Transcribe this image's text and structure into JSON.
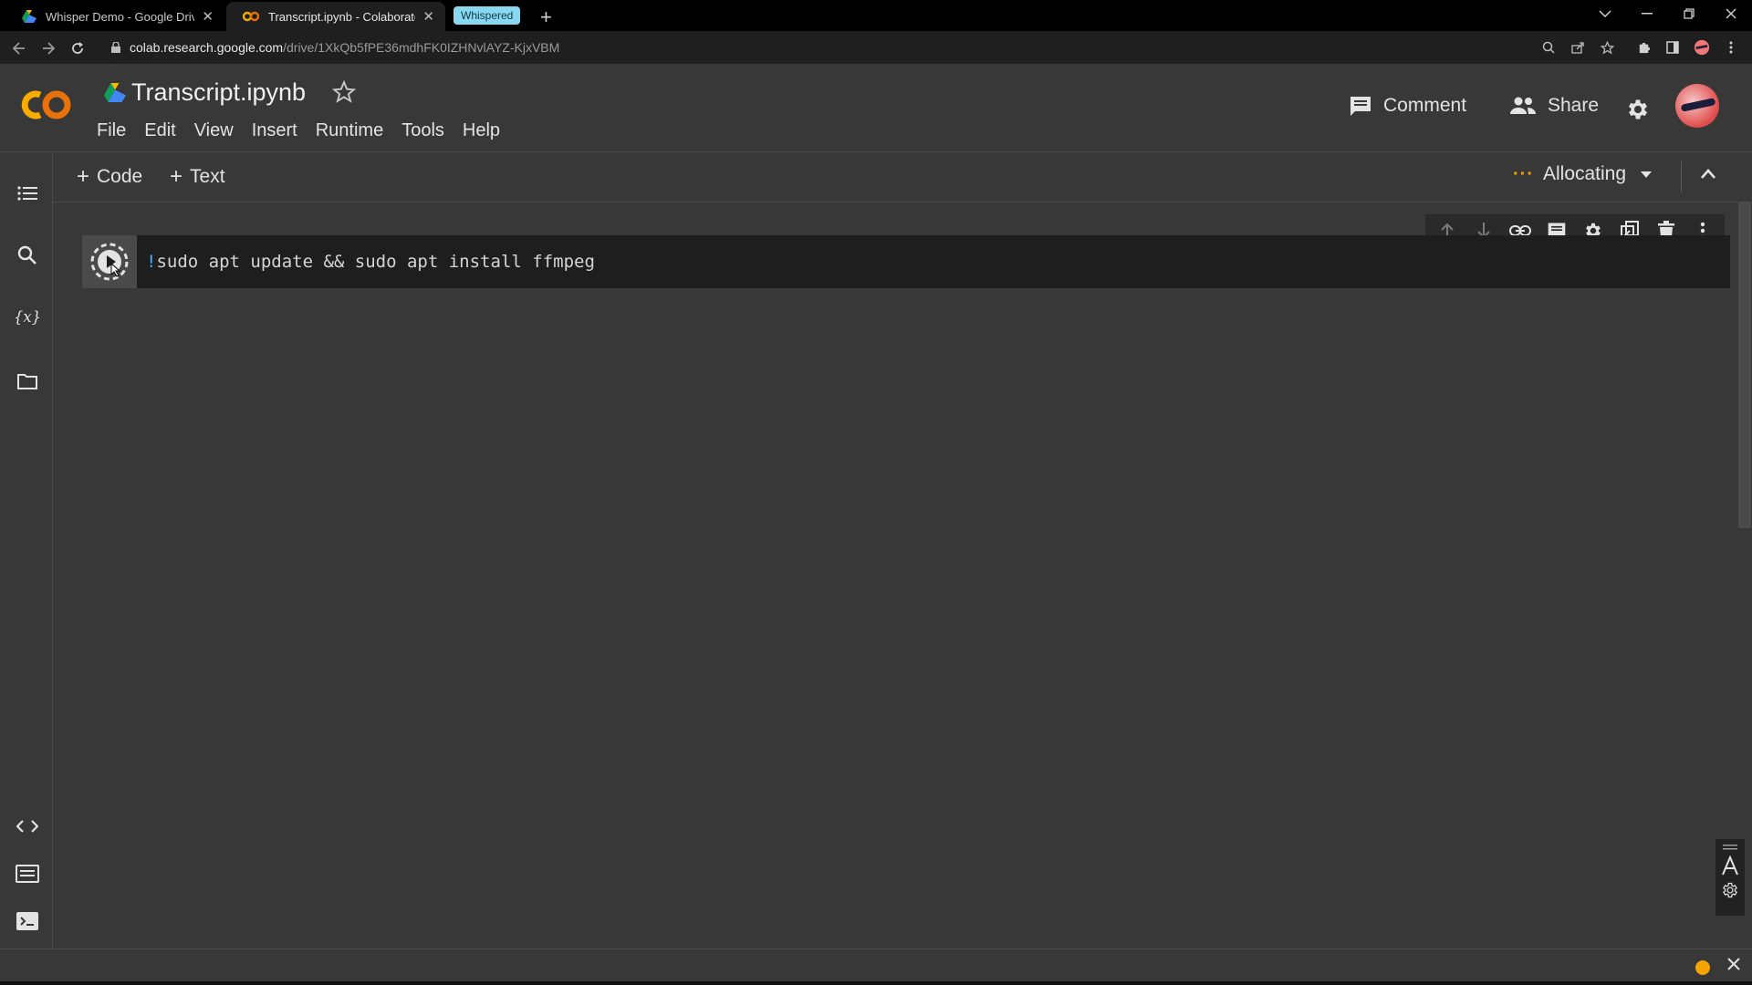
{
  "browser": {
    "tabs": [
      {
        "title": "Whisper Demo - Google Drive",
        "close": "✕"
      },
      {
        "title": "Transcript.ipynb - Colaboratory",
        "close": "✕"
      }
    ],
    "tab_group": "Whispered",
    "new_tab": "+",
    "url_host": "colab.research.google.com",
    "url_path": "/drive/1XkQb5fPE36mdhFK0IZHNvlAYZ-KjxVBM"
  },
  "notebook": {
    "title": "Transcript.ipynb",
    "menu": [
      "File",
      "Edit",
      "View",
      "Insert",
      "Runtime",
      "Tools",
      "Help"
    ],
    "comment_label": "Comment",
    "share_label": "Share"
  },
  "toolbar": {
    "add_code": "Code",
    "add_text": "Text",
    "runtime_status": "Allocating"
  },
  "cell": {
    "bang": "!",
    "code": "sudo apt update && sudo apt install ffmpeg"
  },
  "icons": {
    "toc": "list-icon",
    "search": "search-icon",
    "variables": "variables-icon",
    "files": "folder-icon",
    "code_snippets": "code-icon",
    "command_palette": "keyboard-icon",
    "terminal": "terminal-icon"
  },
  "colors": {
    "background": "#383838",
    "cell_bg": "#1e1e1e",
    "accent_orange": "#f4a300",
    "code_text": "#d4d4d4",
    "tab_group": "#8ad8f0"
  }
}
